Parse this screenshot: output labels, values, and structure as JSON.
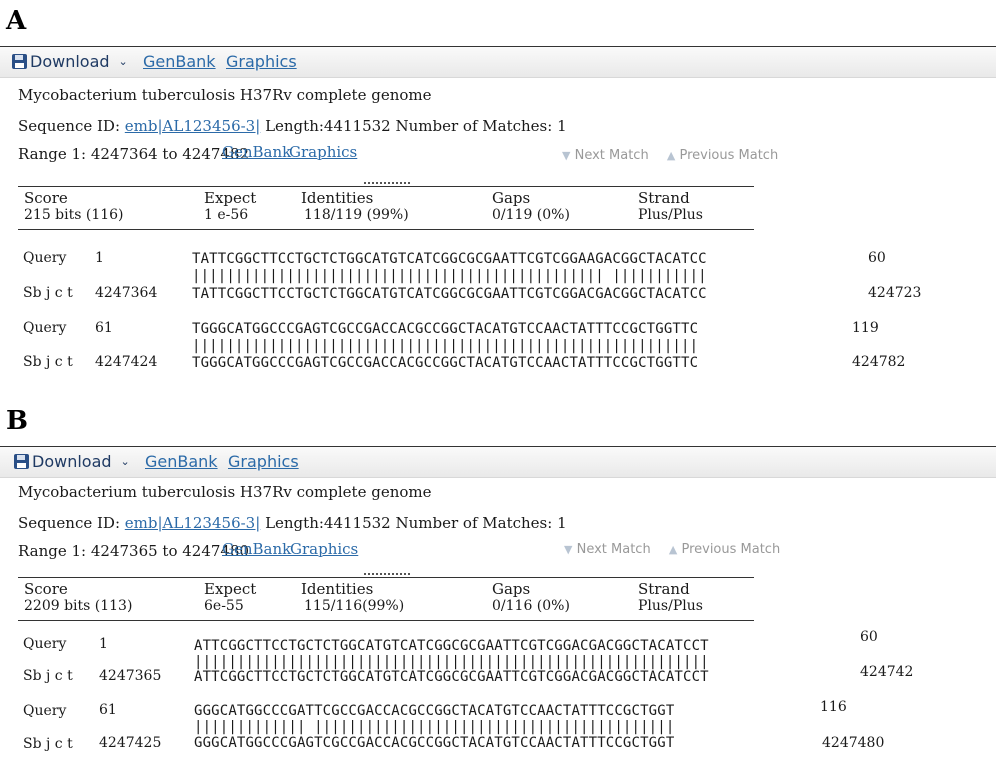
{
  "panels": [
    {
      "letter": "A",
      "toolbar": {
        "download": "Download",
        "genbank": "GenBank",
        "graphics": "Graphics"
      },
      "title": "Mycobacterium tuberculosis H37Rv complete genome",
      "sequence": {
        "id_label": "Sequence ID:",
        "id_link": "emb|AL123456-3|",
        "length": "Length:4411532",
        "matches": "Number of Matches: 1"
      },
      "range": {
        "text": "Range 1: 4247364 to 4247482",
        "genbank": "GenBank",
        "graphics": "Graphics"
      },
      "nav": {
        "next": "Next Match",
        "previous": "Previous Match"
      },
      "stats": {
        "headers": [
          "Score",
          "Expect",
          "Identities",
          "Gaps",
          "Strand"
        ],
        "values": [
          "215 bits (116)",
          "1 e-56",
          "118/119 (99%)",
          "0/119 (0%)",
          "Plus/Plus"
        ]
      },
      "alignment": [
        {
          "q_label": "Query",
          "q_start": "1",
          "q_seq": "TATTCGGCTTCCTGCTCTGGCATGTCATCGGCGCGAATTCGTCGGAAGACGGCTACATCC",
          "q_end": "60",
          "bars": "|||||||||||||||||||||||||||||||||||||||||||||||| |||||||||||",
          "s_label": "Sb j c t",
          "s_start": "4247364",
          "s_seq": "TATTCGGCTTCCTGCTCTGGCATGTCATCGGCGCGAATTCGTCGGACGACGGCTACATCC",
          "s_end": "424723"
        },
        {
          "q_label": "Query",
          "q_start": "61",
          "q_seq": "TGGGCATGGCCCGAGTCGCCGACCACGCCGGCTACATGTCCAACTATTTCCGCTGGTTC",
          "q_end": "119",
          "bars": "|||||||||||||||||||||||||||||||||||||||||||||||||||||||||||",
          "s_label": "Sb j c t",
          "s_start": "4247424",
          "s_seq": "TGGGCATGGCCCGAGTCGCCGACCACGCCGGCTACATGTCCAACTATTTCCGCTGGTTC",
          "s_end": "424782"
        }
      ]
    },
    {
      "letter": "B",
      "toolbar": {
        "download": "Download",
        "genbank": "GenBank",
        "graphics": "Graphics"
      },
      "title": "Mycobacterium tuberculosis H37Rv complete genome",
      "sequence": {
        "id_label": "Sequence ID:",
        "id_link": "emb|AL123456-3|",
        "length": "Length:4411532",
        "matches": "Number of Matches: 1"
      },
      "range": {
        "text": "Range 1: 4247365 to 4247480",
        "genbank": "GenBank",
        "graphics": "Graphics"
      },
      "nav": {
        "next": "Next Match",
        "previous": "Previous Match"
      },
      "stats": {
        "headers": [
          "Score",
          "Expect",
          "Identities",
          "Gaps",
          "Strand"
        ],
        "values": [
          "2209 bits (113)",
          "6e-55",
          "115/116(99%)",
          "0/116 (0%)",
          "Plus/Plus"
        ]
      },
      "alignment": [
        {
          "q_label": "Query",
          "q_start": "1",
          "q_seq": "ATTCGGCTTCCTGCTCTGGCATGTCATCGGCGCGAATTCGTCGGACGACGGCTACATCCT",
          "q_end": "60",
          "bars": "||||||||||||||||||||||||||||||||||||||||||||||||||||||||||||",
          "s_label": "Sb j c t",
          "s_start": "4247365",
          "s_seq": "ATTCGGCTTCCTGCTCTGGCATGTCATCGGCGCGAATTCGTCGGACGACGGCTACATCCT",
          "s_end": "424742"
        },
        {
          "q_label": "Query",
          "q_start": "61",
          "q_seq": "GGGCATGGCCCGATTCGCCGACCACGCCGGCTACATGTCCAACTATTTCCGCTGGT",
          "q_end": "116",
          "bars": "||||||||||||| ||||||||||||||||||||||||||||||||||||||||||",
          "s_label": "Sb j c t",
          "s_start": "4247425",
          "s_seq": "GGGCATGGCCCGAGTCGCCGACCACGCCGGCTACATGTCCAACTATTTCCGCTGGT",
          "s_end": "4247480"
        }
      ]
    }
  ]
}
